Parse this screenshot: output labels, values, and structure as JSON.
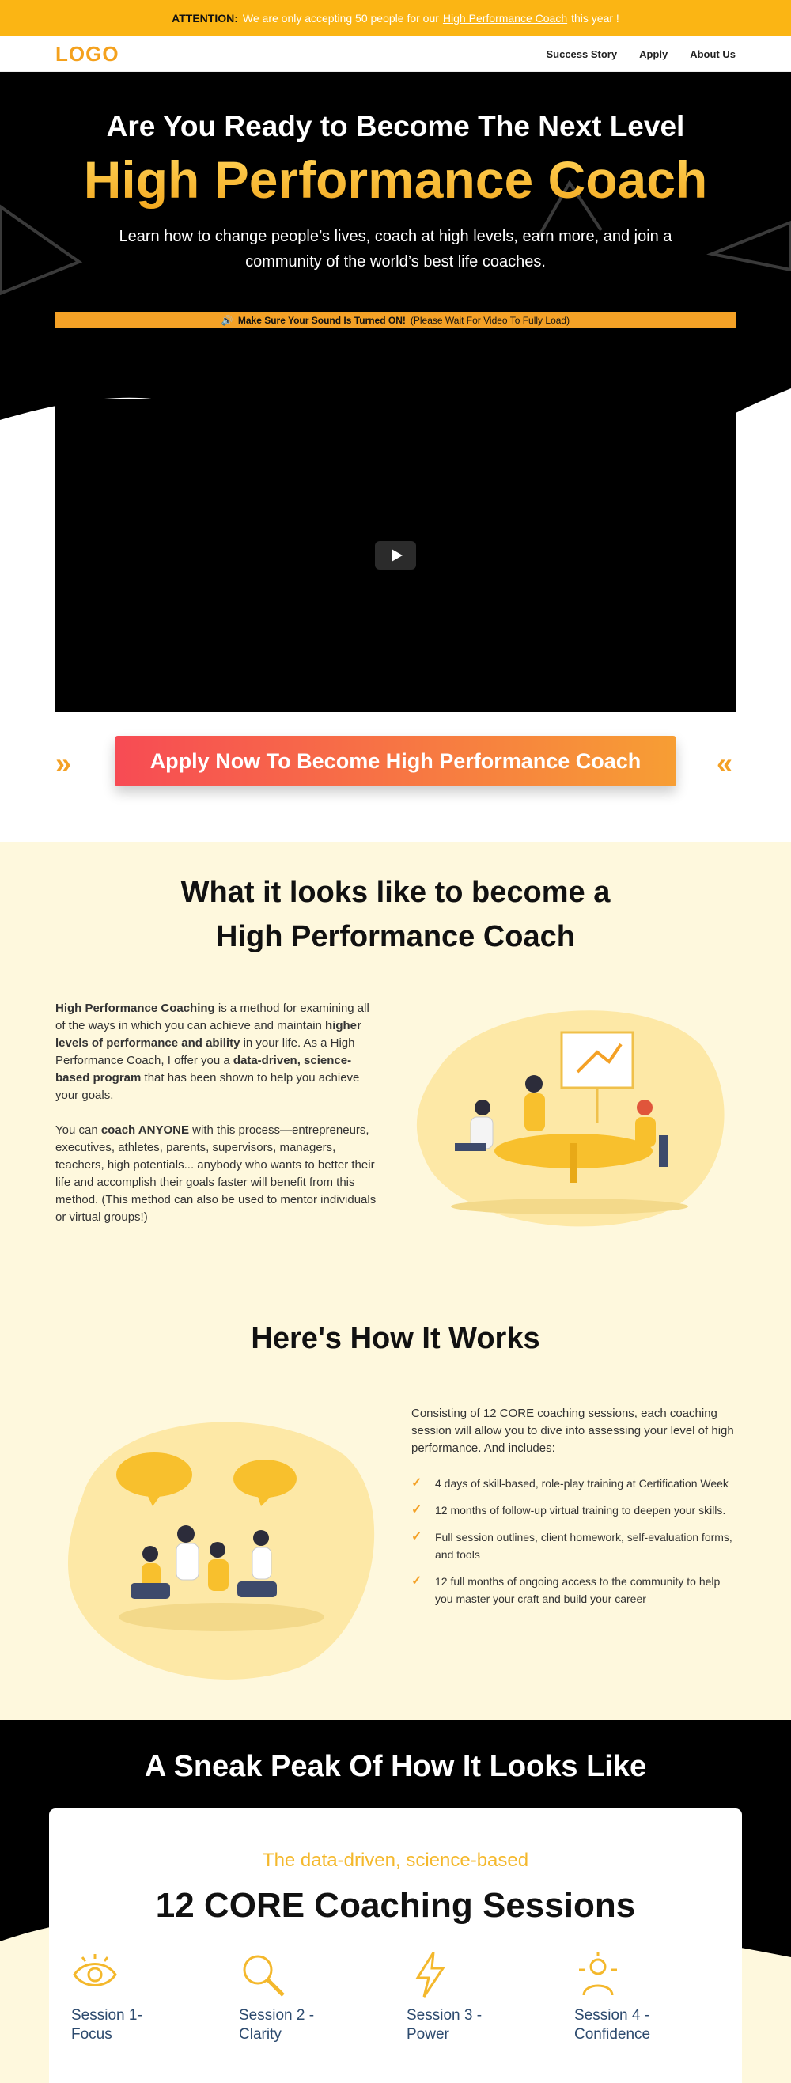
{
  "announcement": {
    "prefix": "ATTENTION:",
    "text_before": "We are only accepting 50 people for our",
    "link": "High Performance Coach",
    "text_after": "this year !"
  },
  "nav": {
    "logo": "LOGO",
    "links": [
      "Success Story",
      "Apply",
      "About Us"
    ]
  },
  "hero": {
    "pre_title": "Are You Ready to Become The Next Level",
    "title": "High Performance Coach",
    "subtitle": "Learn how to change people’s lives, coach at high levels, earn more, and join a community of the world’s best life coaches.",
    "sound_bold": "Make Sure Your Sound Is Turned ON!",
    "sound_note": "(Please Wait For Video To Fully Load)"
  },
  "cta": {
    "label": "Apply Now To Become High Performance Coach"
  },
  "section1": {
    "title_line1": "What it looks like to become a",
    "title_line2": "High Performance Coach",
    "p1_bold1": "High Performance Coaching",
    "p1_text1": " is a method for examining all of the ways in which you can achieve and maintain ",
    "p1_bold2": "higher levels of performance and ability",
    "p1_text2": " in your life. As a High Performance Coach, I offer you a ",
    "p1_bold3": "data-driven, science-based program",
    "p1_text3": " that has been shown to help you achieve your goals.",
    "p2_text1": "You can ",
    "p2_bold1": "coach ANYONE",
    "p2_text2": " with this process—entrepreneurs, executives, athletes, parents, supervisors, managers, teachers, high potentials... anybody who wants to better their life and accomplish their goals faster will benefit from this method. (This method can also be used to mentor individuals or virtual groups!)"
  },
  "section2": {
    "title": "Here's How It Works",
    "intro": "Consisting of 12 CORE coaching sessions, each coaching session will allow you to dive into assessing your level of high performance. And includes:",
    "items": [
      "4 days of skill-based, role-play training at Certification Week",
      "12 months of follow-up virtual training to deepen your skills.",
      "Full session outlines, client homework, self-evaluation forms, and tools",
      "12 full months of ongoing access to the community to help you master your craft and build your career"
    ]
  },
  "sneak": {
    "title": "A Sneak Peak Of How It Looks Like",
    "kicker": "The data-driven, science-based",
    "card_title": "12 CORE Coaching Sessions",
    "sessions": [
      {
        "label": "Session 1- Focus",
        "icon": "eye-icon"
      },
      {
        "label": "Session 2 - Clarity",
        "icon": "magnifier-icon"
      },
      {
        "label": "Session 3 - Power",
        "icon": "lightning-icon"
      },
      {
        "label": "Session 4 - Confidence",
        "icon": "confidence-icon"
      }
    ]
  },
  "colors": {
    "accent": "#fbb514",
    "orange": "#f4a126",
    "cta_start": "#f74b54",
    "cta_end": "#f79e34",
    "cream": "#fef8dd"
  }
}
